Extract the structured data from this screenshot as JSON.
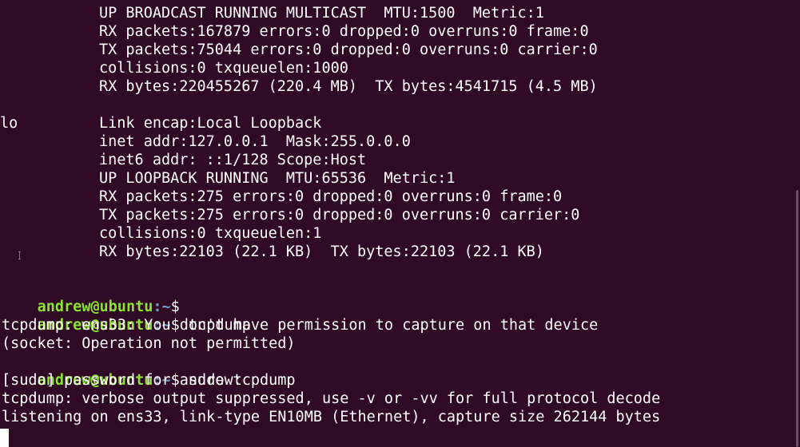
{
  "terminal": {
    "ens33_block": [
      "UP BROADCAST RUNNING MULTICAST  MTU:1500  Metric:1",
      "RX packets:167879 errors:0 dropped:0 overruns:0 frame:0",
      "TX packets:75044 errors:0 dropped:0 overruns:0 carrier:0",
      "collisions:0 txqueuelen:1000",
      "RX bytes:220455267 (220.4 MB)  TX bytes:4541715 (4.5 MB)"
    ],
    "lo_iface_name": "lo",
    "lo_block": [
      "Link encap:Local Loopback",
      "inet addr:127.0.0.1  Mask:255.0.0.0",
      "inet6 addr: ::1/128 Scope:Host",
      "UP LOOPBACK RUNNING  MTU:65536  Metric:1",
      "RX packets:275 errors:0 dropped:0 overruns:0 frame:0",
      "TX packets:275 errors:0 dropped:0 overruns:0 carrier:0",
      "collisions:0 txqueuelen:1",
      "RX bytes:22103 (22.1 KB)  TX bytes:22103 (22.1 KB)"
    ],
    "prompt": {
      "user_host": "andrew@ubuntu",
      "path": ":~",
      "symbol": "$"
    },
    "session": [
      {
        "type": "prompt",
        "command": ""
      },
      {
        "type": "prompt",
        "command": " tcpdump"
      },
      {
        "type": "output",
        "text": "tcpdump: ens33: You don't have permission to capture on that device"
      },
      {
        "type": "output",
        "text": "(socket: Operation not permitted)"
      },
      {
        "type": "prompt",
        "command": " sudo tcpdump"
      },
      {
        "type": "output",
        "text": "[sudo] password for andrew:"
      },
      {
        "type": "output",
        "text": "tcpdump: verbose output suppressed, use -v or -vv for full protocol decode"
      },
      {
        "type": "output",
        "text": "listening on ens33, link-type EN10MB (Ethernet), capture size 262144 bytes"
      }
    ],
    "colors": {
      "background": "#300a24",
      "text": "#ffffff",
      "prompt_user": "#8ae234",
      "prompt_path": "#729fcf"
    }
  }
}
